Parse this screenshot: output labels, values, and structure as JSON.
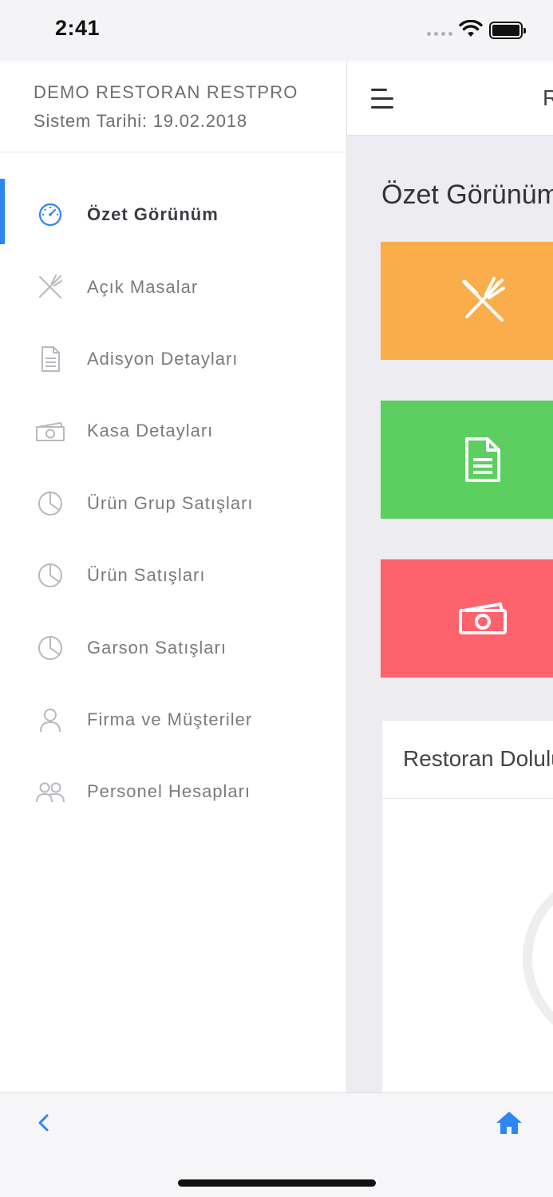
{
  "status_bar": {
    "time": "2:41"
  },
  "drawer": {
    "company": "DEMO RESTORAN RESTPRO",
    "system_date": "Sistem Tarihi: 19.02.2018",
    "items": [
      {
        "label": "Özet Görünüm",
        "icon": "speedometer-icon",
        "active": true
      },
      {
        "label": "Açık Masalar",
        "icon": "fork-knife-icon",
        "active": false
      },
      {
        "label": "Adisyon Detayları",
        "icon": "document-icon",
        "active": false
      },
      {
        "label": "Kasa Detayları",
        "icon": "cash-icon",
        "active": false
      },
      {
        "label": "Ürün Grup Satışları",
        "icon": "pie-chart-icon",
        "active": false
      },
      {
        "label": "Ürün Satışları",
        "icon": "pie-chart-icon",
        "active": false
      },
      {
        "label": "Garson Satışları",
        "icon": "pie-chart-icon",
        "active": false
      },
      {
        "label": "Firma ve Müşteriler",
        "icon": "user-icon",
        "active": false
      },
      {
        "label": "Personel Hesapları",
        "icon": "users-icon",
        "active": false
      }
    ]
  },
  "main": {
    "topbar_title": "R",
    "page_title": "Özet Görünüm",
    "tiles": [
      {
        "icon": "fork-knife-icon",
        "color": "#fbad4c"
      },
      {
        "icon": "document-icon",
        "color": "#5ccf60"
      },
      {
        "icon": "cash-icon",
        "color": "#fe626d"
      }
    ],
    "card_title": "Restoran Doluluk"
  },
  "colors": {
    "accent": "#2e86f5",
    "icon_gray": "#b8b8be"
  }
}
